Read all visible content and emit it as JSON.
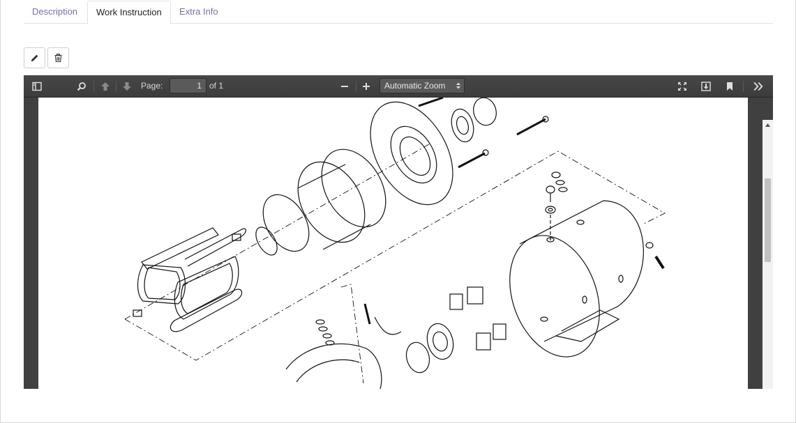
{
  "tabs": [
    {
      "label": "Description",
      "active": false
    },
    {
      "label": "Work Instruction",
      "active": true
    },
    {
      "label": "Extra Info",
      "active": false
    }
  ],
  "actions": {
    "edit_icon": "pencil-icon",
    "delete_icon": "trash-icon"
  },
  "pdf_viewer": {
    "page_label": "Page:",
    "page_number": "1",
    "page_count": "of 1",
    "zoom": "Automatic Zoom",
    "zoom_options": [
      "Automatic Zoom"
    ],
    "document_image": "exploded technical drawing of an electric motor",
    "toolbar_icons": [
      "sidebar-toggle-icon",
      "search-icon",
      "previous-page-icon",
      "next-page-icon",
      "zoom-out-icon",
      "zoom-in-icon",
      "presentation-mode-icon",
      "download-icon",
      "bookmark-icon",
      "tools-icon"
    ]
  },
  "colors": {
    "tab_link": "#7c6fa8",
    "toolbar_bg": "#474747",
    "viewer_bg": "#404040"
  }
}
